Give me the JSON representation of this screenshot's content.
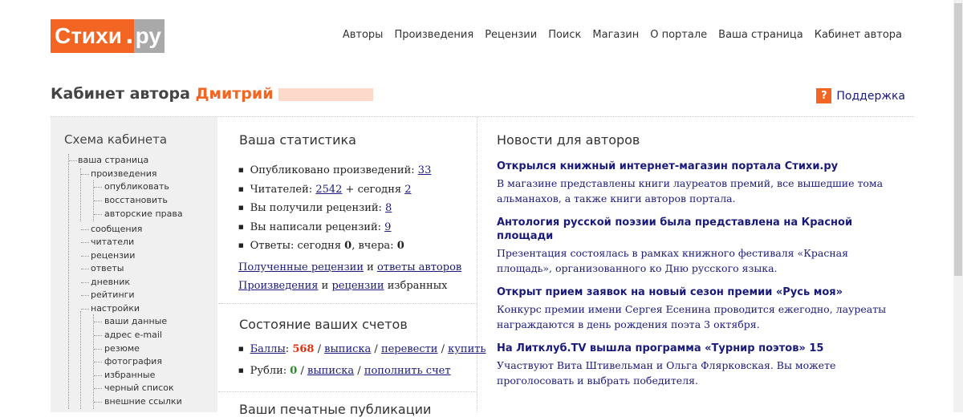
{
  "logo": {
    "main": "Стихи",
    "dot": ".",
    "tld": "ру"
  },
  "nav": [
    "Авторы",
    "Произведения",
    "Рецензии",
    "Поиск",
    "Магазин",
    "О портале",
    "Ваша страница",
    "Кабинет автора"
  ],
  "page": {
    "title_prefix": "Кабинет автора",
    "author": "Дмитрий"
  },
  "support": {
    "icon": "?",
    "label": "Поддержка"
  },
  "tree": {
    "title": "Схема кабинета",
    "items": [
      "ваша страница",
      "произведения",
      "опубликовать",
      "восстановить",
      "авторские права",
      "сообщения",
      "читатели",
      "рецензии",
      "ответы",
      "дневник",
      "рейтинги",
      "настройки",
      "ваши данные",
      "адрес e-mail",
      "резюме",
      "фотография",
      "избранные",
      "черный список",
      "внешние ссылки"
    ]
  },
  "stats": {
    "title": "Ваша статистика",
    "published_label": "Опубликовано произведений:",
    "published_value": "33",
    "readers_label": "Читателей:",
    "readers_value": "2542",
    "readers_today_label": "+ сегодня",
    "readers_today_value": "2",
    "received_label": "Вы получили рецензий:",
    "received_value": "8",
    "written_label": "Вы написали рецензий:",
    "written_value": "9",
    "answers_label": "Ответы: сегодня",
    "answers_today": "0",
    "answers_yesterday_label": ", вчера:",
    "answers_yesterday": "0",
    "link1": "Полученные рецензии",
    "and1": "и",
    "link2": "ответы авторов",
    "link3": "Произведения",
    "and2": "и",
    "link4": "рецензии",
    "tail": "избранных"
  },
  "accounts": {
    "title": "Состояние ваших счетов",
    "points_label": "Баллы",
    "points_colon": ":",
    "points_value": "568",
    "points_l1": "выписка",
    "points_l2": "перевести",
    "points_l3": "купить",
    "rub_label": "Рубли:",
    "rub_value": "0",
    "rub_l1": "выписка",
    "rub_l2": "пополнить счет"
  },
  "print": {
    "title": "Ваши печатные публикации"
  },
  "news": {
    "title": "Новости для авторов",
    "items": [
      {
        "head": "Открылся книжный интернет-магазин портала Стихи.ру",
        "body": "В магазине представлены книги лауреатов премий, все вышедшие тома альманахов, а также книги авторов портала."
      },
      {
        "head": "Антология русской поэзии была представлена на Красной площади",
        "body": "Презентация состоялась в рамках книжного фестиваля «Красная площадь», организованного ко Дню русского языка."
      },
      {
        "head": "Открыт прием заявок на новый сезон премии «Русь моя»",
        "body": "Конкурс премии имени Сергея Есенина проводится ежегодно, лауреаты награждаются в день рождения поэта 3 октября."
      },
      {
        "head": "На Литклуб.TV вышла программа «Турнир поэтов» 15",
        "body": "Участвуют Вита Штивельман и Ольга Флярковская. Вы можете проголосовать и выбрать победителя."
      }
    ]
  }
}
